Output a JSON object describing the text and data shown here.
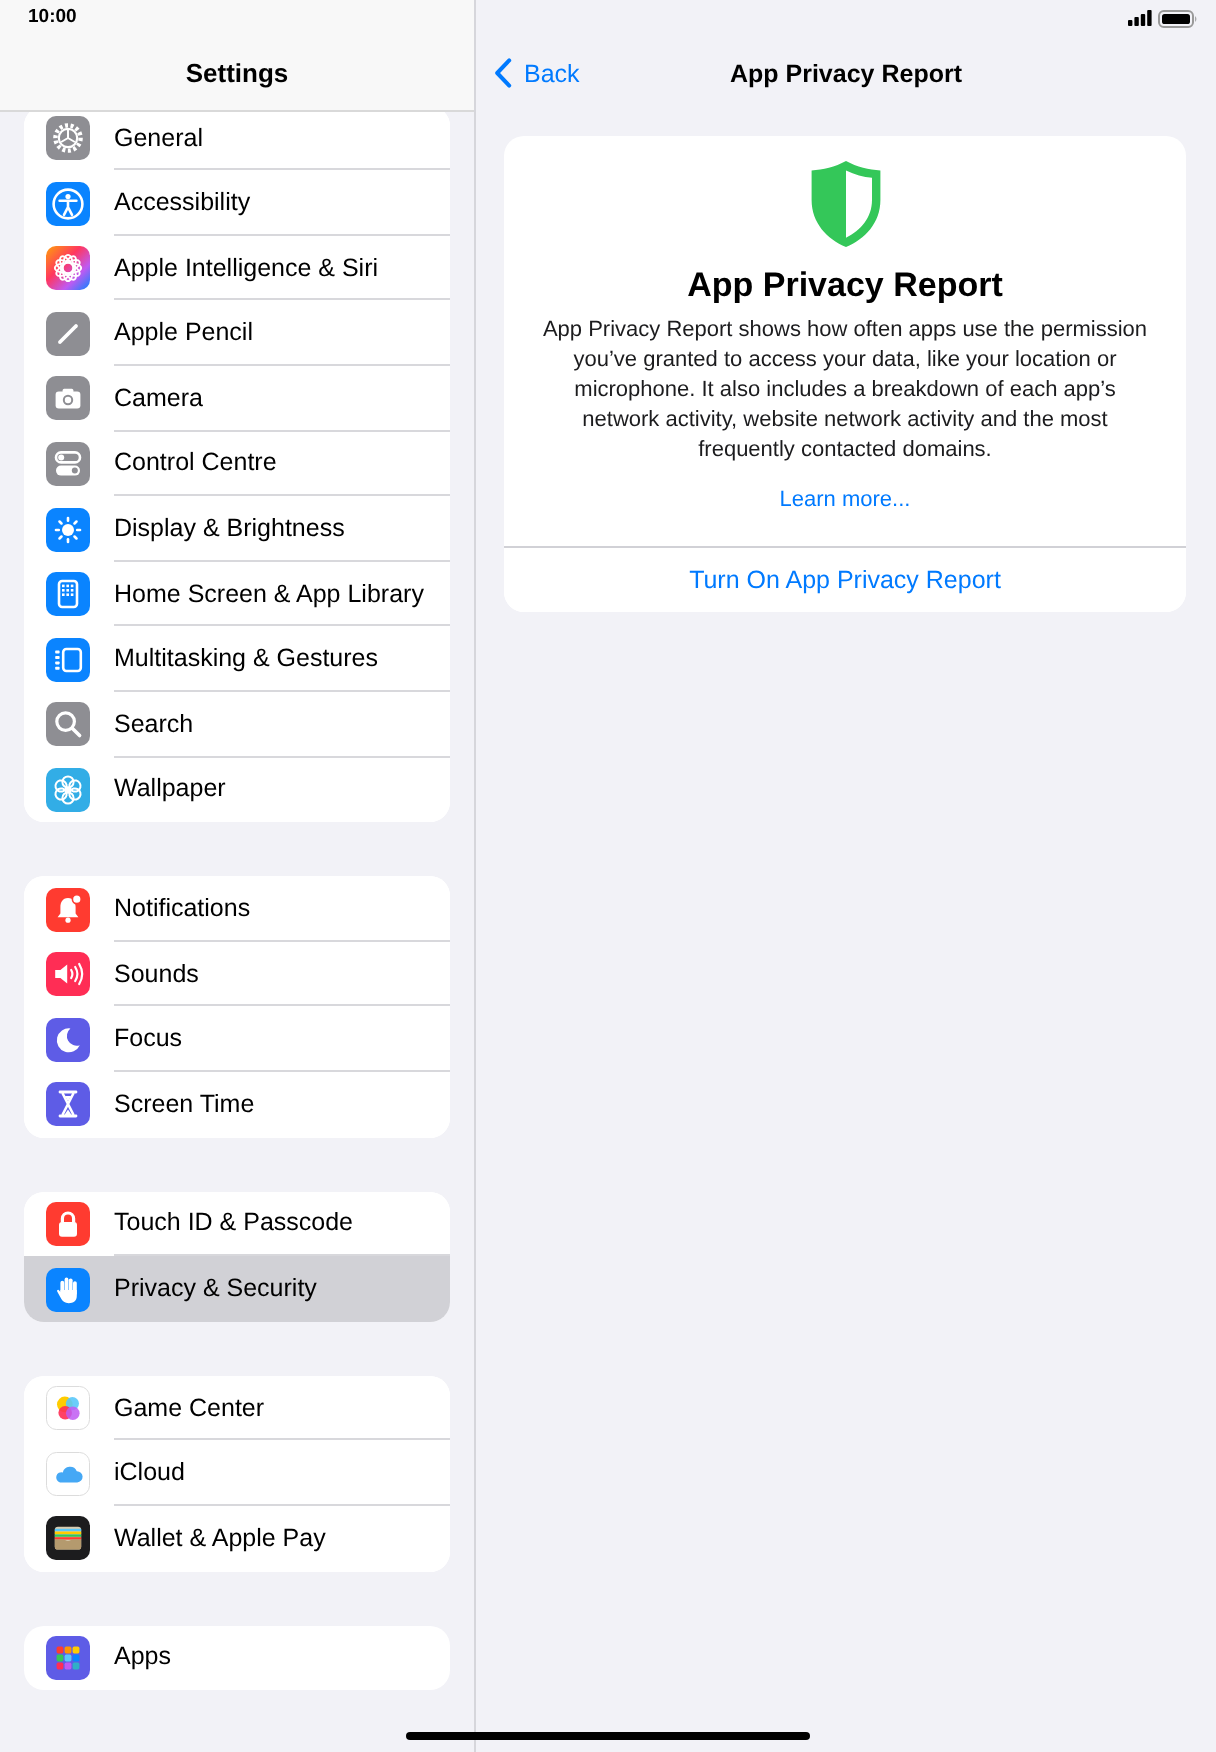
{
  "status_bar": {
    "time": "10:00"
  },
  "sidebar": {
    "title": "Settings",
    "groups": [
      {
        "items": [
          {
            "label": "General",
            "selected": false
          },
          {
            "label": "Accessibility",
            "selected": false
          },
          {
            "label": "Apple Intelligence & Siri",
            "selected": false
          },
          {
            "label": "Apple Pencil",
            "selected": false
          },
          {
            "label": "Camera",
            "selected": false
          },
          {
            "label": "Control Centre",
            "selected": false
          },
          {
            "label": "Display & Brightness",
            "selected": false
          },
          {
            "label": "Home Screen & App Library",
            "selected": false
          },
          {
            "label": "Multitasking & Gestures",
            "selected": false
          },
          {
            "label": "Search",
            "selected": false
          },
          {
            "label": "Wallpaper",
            "selected": false
          }
        ]
      },
      {
        "items": [
          {
            "label": "Notifications",
            "selected": false
          },
          {
            "label": "Sounds",
            "selected": false
          },
          {
            "label": "Focus",
            "selected": false
          },
          {
            "label": "Screen Time",
            "selected": false
          }
        ]
      },
      {
        "items": [
          {
            "label": "Touch ID & Passcode",
            "selected": false
          },
          {
            "label": "Privacy & Security",
            "selected": true
          }
        ]
      },
      {
        "items": [
          {
            "label": "Game Center",
            "selected": false
          },
          {
            "label": "iCloud",
            "selected": false
          },
          {
            "label": "Wallet & Apple Pay",
            "selected": false
          }
        ]
      },
      {
        "items": [
          {
            "label": "Apps",
            "selected": false
          }
        ]
      }
    ]
  },
  "detail": {
    "back": "Back",
    "title": "App Privacy Report",
    "card": {
      "title": "App Privacy Report",
      "description": "App Privacy Report shows how often apps use the permission you’ve granted to access your data, like your location or microphone. It also includes a breakdown of each app’s network activity, website network activity and the most frequently contacted domains.",
      "link": "Learn more...",
      "action": "Turn On App Privacy Report"
    }
  }
}
